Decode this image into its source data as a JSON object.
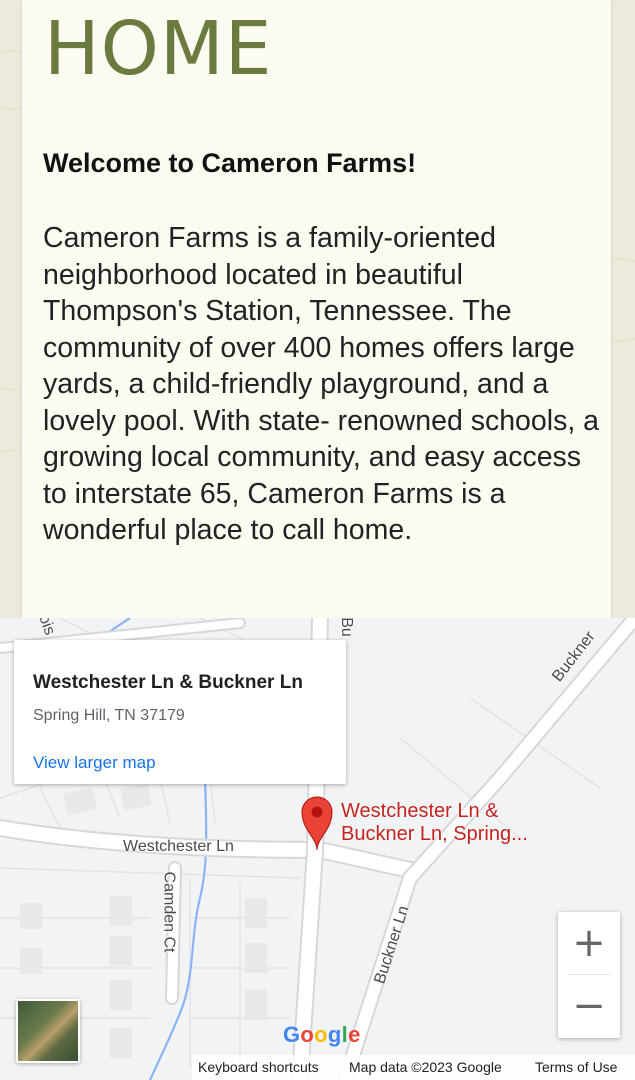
{
  "page": {
    "title": "HOME",
    "welcome_heading": "Welcome to Cameron Farms!",
    "intro": "Cameron Farms is a family-oriented neighborhood located in beautiful Thompson's Station, Tennessee. The community of over 400 homes offers large yards, a child-friendly playground, and a lovely pool. With state- renowned schools, a growing local community, and easy access to interstate 65, Cameron Farms is a wonderful place to call home."
  },
  "map": {
    "info_card": {
      "title": "Westchester Ln & Buckner Ln",
      "address": "Spring Hill, TN 37179",
      "link": "View larger map"
    },
    "pin_label": [
      "Westchester Ln &",
      "Buckner Ln, Spring..."
    ],
    "streets": {
      "westchester": "Westchester Ln",
      "camden": "Camden Ct",
      "buckner_lower": "Buckner Ln",
      "buckner_upper": "Buckner",
      "fragment_left": "ois",
      "fragment_mid": "Bu"
    },
    "zoom_in": "+",
    "zoom_out": "−",
    "footer": {
      "shortcuts": "Keyboard shortcuts",
      "map_data": "Map data ©2023 Google",
      "terms": "Terms of Use"
    },
    "logo_letters": [
      "G",
      "o",
      "o",
      "g",
      "l",
      "e"
    ],
    "colors": {
      "brand_green": "#6b7a3e",
      "link_blue": "#1a73e8",
      "pin_red": "#ea4335",
      "pin_text": "#c5221f"
    }
  }
}
